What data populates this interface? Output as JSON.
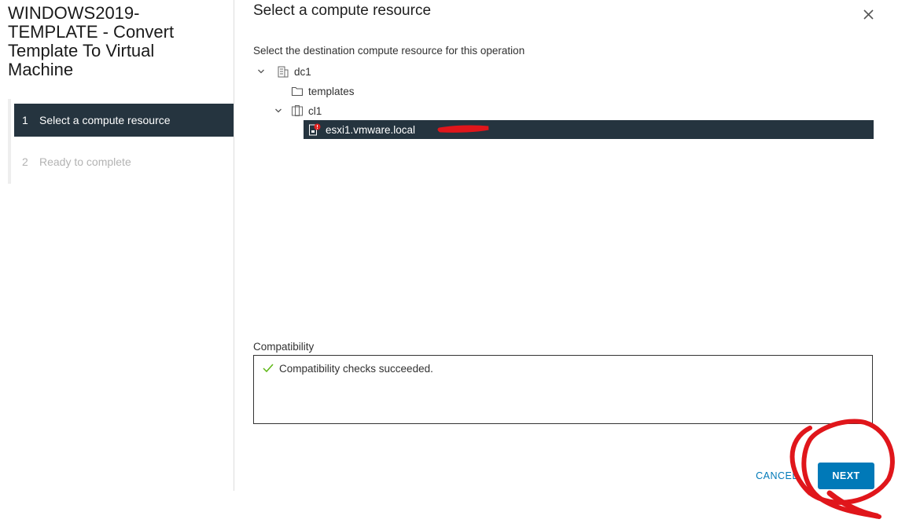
{
  "wizard": {
    "title": "WINDOWS2019-TEMPLATE - Convert Template To Virtual Machine",
    "steps": [
      {
        "number": "1",
        "label": "Select a compute resource",
        "state": "active"
      },
      {
        "number": "2",
        "label": "Ready to complete",
        "state": "inactive"
      }
    ]
  },
  "content": {
    "title": "Select a compute resource",
    "instructions": "Select the destination compute resource for this operation"
  },
  "tree": {
    "datacenter": {
      "label": "dc1",
      "icon": "datacenter-icon",
      "expanded": true
    },
    "folder": {
      "label": "templates",
      "icon": "folder-icon"
    },
    "cluster": {
      "label": "cl1",
      "icon": "cluster-icon",
      "expanded": true
    },
    "host": {
      "label": "esxi1.vmware.local",
      "icon": "host-warning-icon",
      "selected": true
    }
  },
  "compatibility": {
    "label": "Compatibility",
    "message": "Compatibility checks succeeded.",
    "status_color": "#5eb715"
  },
  "buttons": {
    "cancel": "CANCEL",
    "next": "NEXT"
  },
  "colors": {
    "selected_bg": "#25343f",
    "primary": "#0079b8",
    "annotation": "#e0161b"
  }
}
